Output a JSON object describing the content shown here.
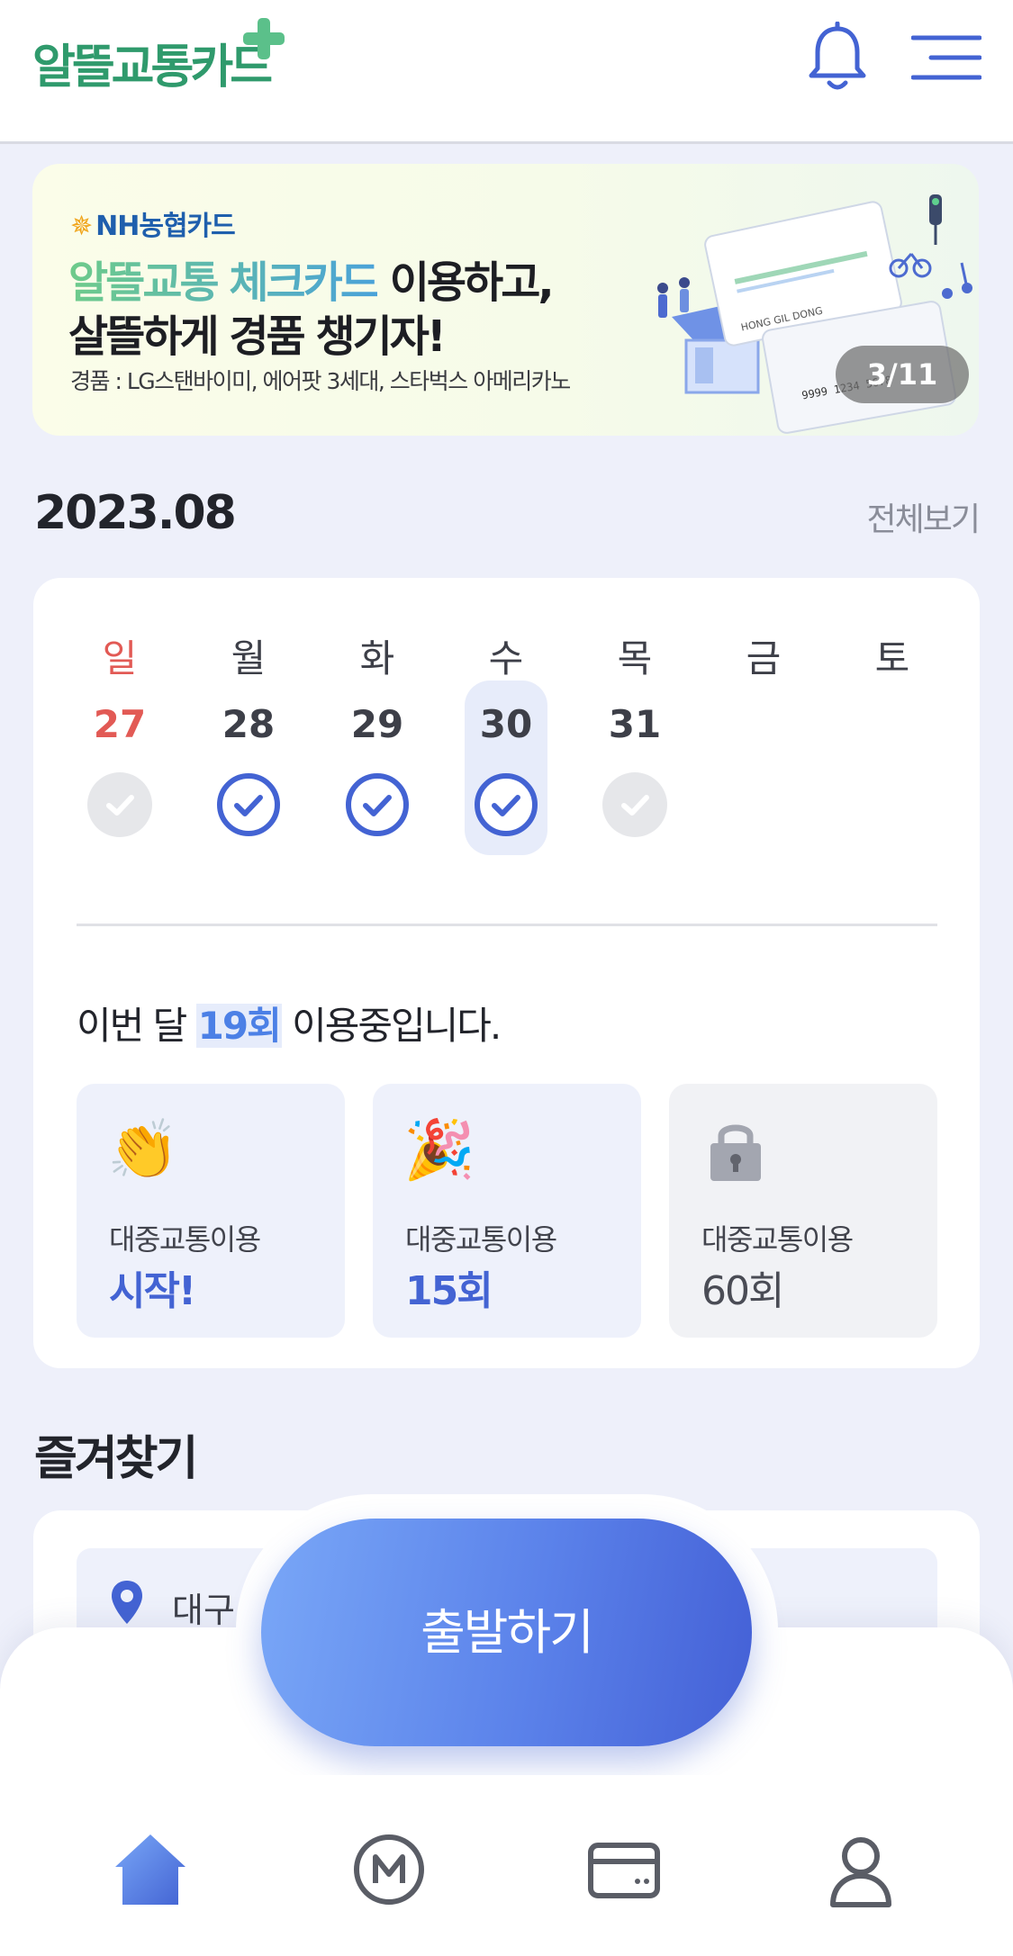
{
  "header": {
    "logo_text": "알뜰교통카드",
    "bell_icon": "bell-icon",
    "menu_icon": "hamburger-menu-icon"
  },
  "banner": {
    "brand": "NH농협카드",
    "headline_highlight": "알뜰교통 체크카드",
    "headline_rest": " 이용하고,",
    "headline_line2": "살뜰하게 경품 챙기자!",
    "note": "경품 : LG스탠바이미, 에어팟 3세대, 스타벅스 아메리카노",
    "card_text": "HONG GIL DONG",
    "card_number": "9999 1234 5678",
    "page_indicator": "3/11"
  },
  "month": {
    "title": "2023.08",
    "view_all": "전체보기"
  },
  "calendar": {
    "days": [
      {
        "weekday": "일",
        "date": "27",
        "status": "future-gray",
        "sunday": true
      },
      {
        "weekday": "월",
        "date": "28",
        "status": "checked"
      },
      {
        "weekday": "화",
        "date": "29",
        "status": "checked"
      },
      {
        "weekday": "수",
        "date": "30",
        "status": "checked",
        "selected": true
      },
      {
        "weekday": "목",
        "date": "31",
        "status": "future-gray"
      },
      {
        "weekday": "금",
        "date": ""
      },
      {
        "weekday": "토",
        "date": ""
      }
    ],
    "accent_color": "#4363d3",
    "sunday_color": "#e25a55"
  },
  "usage": {
    "prefix": "이번 달 ",
    "count": "19회",
    "suffix": " 이용중입니다."
  },
  "milestones": [
    {
      "icon": "clapping-hands-icon",
      "glyph": "👏",
      "label": "대중교통이용",
      "value": "시작!",
      "achieved": true
    },
    {
      "icon": "party-popper-icon",
      "glyph": "🎉",
      "label": "대중교통이용",
      "value": "15회",
      "achieved": true
    },
    {
      "icon": "lock-icon",
      "glyph": "",
      "label": "대중교통이용",
      "value": "60회",
      "achieved": false
    }
  ],
  "favorites": {
    "title": "즐겨찾기",
    "items": [
      {
        "icon": "location-pin-icon",
        "text": "대구"
      }
    ]
  },
  "start_button": {
    "label": "출발하기"
  },
  "tabbar": {
    "tabs": [
      {
        "icon": "home-icon",
        "active": true
      },
      {
        "icon": "mileage-m-icon",
        "active": false
      },
      {
        "icon": "card-icon",
        "active": false
      },
      {
        "icon": "profile-icon",
        "active": false
      }
    ]
  }
}
